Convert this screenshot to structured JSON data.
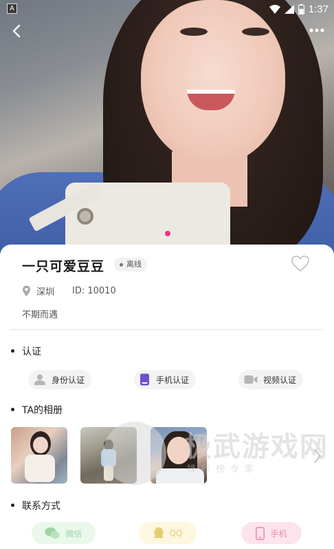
{
  "statusbar": {
    "time": "1:37",
    "notification_glyph": "A"
  },
  "profile": {
    "name": "一只可爱豆豆",
    "status_badge": "离线",
    "location": "深圳",
    "id_text": "ID: 10010",
    "bio": "不期而遇"
  },
  "sections": {
    "verification": {
      "title": "认证",
      "items": [
        {
          "label": "身份认证",
          "icon": "person-icon"
        },
        {
          "label": "手机认证",
          "icon": "phone-icon"
        },
        {
          "label": "视频认证",
          "icon": "video-camera-icon"
        }
      ]
    },
    "album": {
      "title": "TA的相册",
      "photo_count_visible": 3
    },
    "contact": {
      "title": "联系方式",
      "items": [
        {
          "label": "微信",
          "icon": "wechat-icon",
          "color": "#9cd4a6"
        },
        {
          "label": "QQ",
          "icon": "qq-icon",
          "color": "#e8cc73"
        },
        {
          "label": "手机",
          "icon": "mobile-phone-icon",
          "color": "#f08ab0"
        }
      ]
    }
  },
  "watermark": {
    "title": "极武游戏网",
    "subtitle": "排行榜专家"
  },
  "colors": {
    "accent": "#f0357a",
    "badge_bg": "#f2f2f2"
  }
}
